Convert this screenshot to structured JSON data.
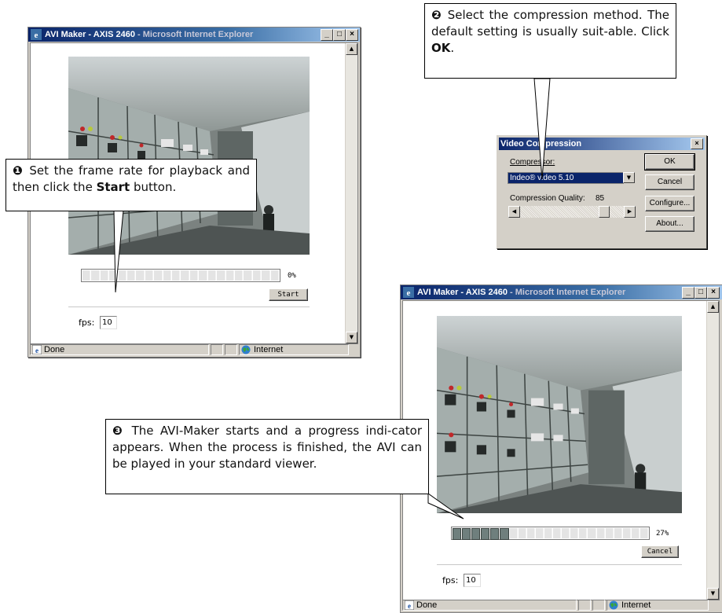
{
  "window1": {
    "title_app": "AVI Maker - AXIS 2460",
    "title_sep": " - ",
    "title_browser": "Microsoft Internet Explorer",
    "min_glyph": "_",
    "max_glyph": "□",
    "close_glyph": "×",
    "progress_percent": "0%",
    "progress_fraction": 0,
    "start_label": "Start",
    "fps_label": "fps:",
    "fps_value": "10",
    "status_text": "Done",
    "zone_text": "Internet"
  },
  "window2": {
    "title_app": "AVI Maker - AXIS 2460",
    "title_sep": " - ",
    "title_browser": "Microsoft Internet Explorer",
    "min_glyph": "_",
    "max_glyph": "□",
    "close_glyph": "×",
    "progress_percent": "27%",
    "progress_fraction": 0.27,
    "cancel_label": "Cancel",
    "fps_label": "fps:",
    "fps_value": "10",
    "status_text": "Done",
    "zone_text": "Internet"
  },
  "dialog": {
    "title": "Video Compression",
    "close_glyph": "×",
    "compressor_label": "Compressor:",
    "compressor_value": "Indeo® video 5.10",
    "quality_label": "Compression Quality:",
    "quality_value": "85",
    "ok_label": "OK",
    "cancel_label": "Cancel",
    "configure_label": "Configure...",
    "about_label": "About..."
  },
  "callouts": {
    "step1": {
      "number": "❶",
      "text_before": " Set the frame rate for playback and then click the ",
      "bold": "Start",
      "text_after": " button."
    },
    "step2": {
      "number": "❷",
      "text_before": " Select the compression method. The default setting is usually suit-able. Click ",
      "bold": "OK",
      "text_after": "."
    },
    "step3": {
      "number": "❸",
      "text_before": " The AVI-Maker starts and a progress indi-cator appears. When the process is finished, the AVI can be played in your standard viewer.",
      "bold": "",
      "text_after": ""
    }
  },
  "colors": {
    "titlebar_start": "#0a246a",
    "titlebar_end": "#a6caf0",
    "chrome": "#d4d0c8",
    "progress_fill": "#6f7f7d"
  }
}
